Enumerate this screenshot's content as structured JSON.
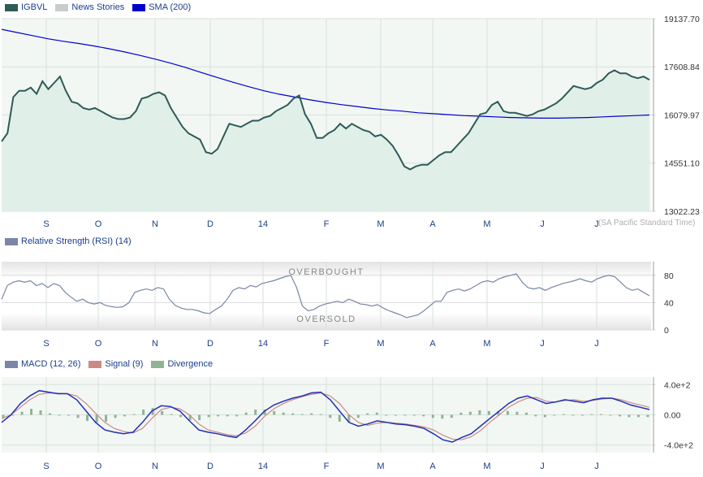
{
  "price_panel": {
    "legend": [
      {
        "label": "IGBVL",
        "color": "#2e5b57"
      },
      {
        "label": "News Stories",
        "color": "#c8cdcc"
      },
      {
        "label": "SMA (200)",
        "color": "#0000cc"
      }
    ],
    "timezone_note": "(SA Pacific Standard Time)"
  },
  "rsi_panel": {
    "legend": [
      {
        "label": "Relative Strength (RSI) (14)",
        "color": "#7a86a8"
      }
    ],
    "overbought_label": "OVERBOUGHT",
    "oversold_label": "OVERSOLD"
  },
  "macd_panel": {
    "legend": [
      {
        "label": "MACD (12, 26)",
        "color": "#7a86a8"
      },
      {
        "label": "Signal (9)",
        "color": "#cc8a84"
      },
      {
        "label": "Divergence",
        "color": "#8fb393"
      }
    ]
  },
  "x_axis": {
    "labels": [
      "S",
      "O",
      "N",
      "D",
      "14",
      "F",
      "M",
      "A",
      "M",
      "J",
      "J"
    ]
  },
  "chart_data": [
    {
      "type": "line",
      "panel": "price",
      "x_ticks": [
        "S",
        "O",
        "N",
        "D",
        "14",
        "F",
        "M",
        "A",
        "M",
        "J",
        "J"
      ],
      "y_ticks": [
        "19137.70",
        "17608.84",
        "16079.97",
        "14551.10",
        "13022.23"
      ],
      "ylim": [
        13022.23,
        19137.7
      ],
      "series": [
        {
          "name": "IGBVL",
          "color": "#2e5b57",
          "values": [
            15240,
            15500,
            16650,
            16850,
            16850,
            16950,
            16750,
            17150,
            16900,
            17100,
            17300,
            16850,
            16500,
            16450,
            16300,
            16250,
            16300,
            16200,
            16100,
            16000,
            15950,
            15950,
            16000,
            16200,
            16600,
            16650,
            16750,
            16800,
            16700,
            16300,
            16000,
            15700,
            15500,
            15400,
            15300,
            14900,
            14850,
            15000,
            15400,
            15800,
            15750,
            15700,
            15800,
            15900,
            15900,
            16000,
            16050,
            16200,
            16300,
            16400,
            16600,
            16700,
            16100,
            15800,
            15350,
            15350,
            15500,
            15600,
            15800,
            15650,
            15800,
            15700,
            15600,
            15550,
            15400,
            15450,
            15300,
            15100,
            14800,
            14450,
            14350,
            14450,
            14500,
            14500,
            14650,
            14800,
            14900,
            14900,
            15100,
            15300,
            15500,
            15800,
            16100,
            16150,
            16400,
            16500,
            16200,
            16150,
            16150,
            16100,
            16050,
            16100,
            16200,
            16250,
            16350,
            16450,
            16600,
            16800,
            17000,
            16950,
            16900,
            16950,
            17100,
            17200,
            17400,
            17500,
            17400,
            17400,
            17300,
            17250,
            17300,
            17200
          ]
        },
        {
          "name": "SMA (200)",
          "color": "#0000cc",
          "values": [
            18800,
            18700,
            18600,
            18500,
            18420,
            18350,
            18270,
            18180,
            18080,
            17970,
            17850,
            17720,
            17580,
            17420,
            17270,
            17120,
            16980,
            16850,
            16740,
            16650,
            16560,
            16480,
            16410,
            16350,
            16290,
            16240,
            16200,
            16150,
            16120,
            16090,
            16060,
            16040,
            16020,
            16000,
            15990,
            15980,
            15980,
            15990,
            16000,
            16020,
            16040,
            16060,
            16080
          ]
        }
      ]
    },
    {
      "type": "line",
      "panel": "rsi",
      "x_ticks": [
        "S",
        "O",
        "N",
        "D",
        "14",
        "F",
        "M",
        "A",
        "M",
        "J",
        "J"
      ],
      "y_ticks": [
        "80",
        "40",
        "0"
      ],
      "ylim": [
        0,
        100
      ],
      "series": [
        {
          "name": "Relative Strength (RSI) (14)",
          "color": "#7a86a8",
          "values": [
            45,
            65,
            70,
            72,
            70,
            72,
            65,
            68,
            62,
            68,
            65,
            55,
            48,
            42,
            45,
            40,
            38,
            40,
            36,
            34,
            33,
            34,
            40,
            55,
            58,
            60,
            58,
            62,
            60,
            45,
            36,
            32,
            30,
            30,
            28,
            25,
            24,
            30,
            35,
            45,
            58,
            62,
            60,
            65,
            63,
            68,
            70,
            72,
            75,
            78,
            80,
            62,
            35,
            28,
            30,
            35,
            38,
            40,
            42,
            40,
            45,
            42,
            38,
            37,
            35,
            37,
            32,
            28,
            25,
            22,
            18,
            20,
            22,
            28,
            35,
            42,
            42,
            55,
            58,
            60,
            57,
            60,
            65,
            70,
            72,
            70,
            75,
            78,
            80,
            82,
            70,
            62,
            60,
            62,
            58,
            62,
            65,
            68,
            70,
            72,
            75,
            72,
            70,
            75,
            78,
            80,
            78,
            70,
            62,
            58,
            60,
            55,
            50
          ]
        }
      ]
    },
    {
      "type": "line",
      "panel": "macd",
      "x_ticks": [
        "S",
        "O",
        "N",
        "D",
        "14",
        "F",
        "M",
        "A",
        "M",
        "J",
        "J"
      ],
      "y_ticks": [
        "4.0e+2",
        "0.00",
        "-4.0e+2"
      ],
      "ylim": [
        -500,
        500
      ],
      "series": [
        {
          "name": "MACD (12, 26)",
          "color": "#1f2fb8",
          "values": [
            -100,
            0,
            150,
            250,
            320,
            300,
            280,
            280,
            200,
            50,
            -100,
            -200,
            -230,
            -250,
            -230,
            -100,
            50,
            120,
            110,
            50,
            -80,
            -200,
            -230,
            -250,
            -280,
            -300,
            -200,
            -80,
            50,
            130,
            180,
            220,
            250,
            290,
            300,
            200,
            50,
            -100,
            -150,
            -120,
            -80,
            -100,
            -120,
            -130,
            -150,
            -180,
            -250,
            -330,
            -360,
            -300,
            -250,
            -150,
            -50,
            50,
            150,
            220,
            250,
            200,
            150,
            170,
            200,
            180,
            160,
            200,
            220,
            220,
            180,
            130,
            100,
            70
          ]
        },
        {
          "name": "Signal (9)",
          "color": "#cc8a84",
          "values": [
            -50,
            0,
            100,
            200,
            270,
            290,
            285,
            280,
            250,
            150,
            20,
            -100,
            -180,
            -220,
            -240,
            -180,
            -50,
            70,
            100,
            80,
            0,
            -120,
            -200,
            -230,
            -260,
            -280,
            -240,
            -150,
            -20,
            80,
            150,
            200,
            240,
            270,
            290,
            250,
            150,
            0,
            -100,
            -140,
            -110,
            -100,
            -110,
            -120,
            -140,
            -160,
            -200,
            -270,
            -320,
            -330,
            -290,
            -210,
            -100,
            0,
            100,
            170,
            220,
            230,
            180,
            170,
            190,
            200,
            180,
            190,
            210,
            220,
            200,
            160,
            130,
            100
          ]
        },
        {
          "name": "Divergence",
          "color": "#8fb393",
          "values": [
            -40,
            0,
            40,
            80,
            60,
            20,
            0,
            0,
            -40,
            -80,
            -100,
            -90,
            -40,
            -20,
            10,
            70,
            90,
            50,
            10,
            -30,
            -70,
            -70,
            -30,
            -20,
            -20,
            -20,
            30,
            70,
            70,
            50,
            30,
            20,
            10,
            20,
            10,
            -40,
            -90,
            -100,
            -40,
            20,
            30,
            0,
            -10,
            -10,
            -10,
            -20,
            -40,
            -50,
            -40,
            30,
            40,
            60,
            50,
            50,
            50,
            40,
            30,
            -20,
            -30,
            0,
            10,
            -10,
            -10,
            10,
            10,
            0,
            -20,
            -30,
            -30,
            -30
          ]
        }
      ]
    }
  ]
}
